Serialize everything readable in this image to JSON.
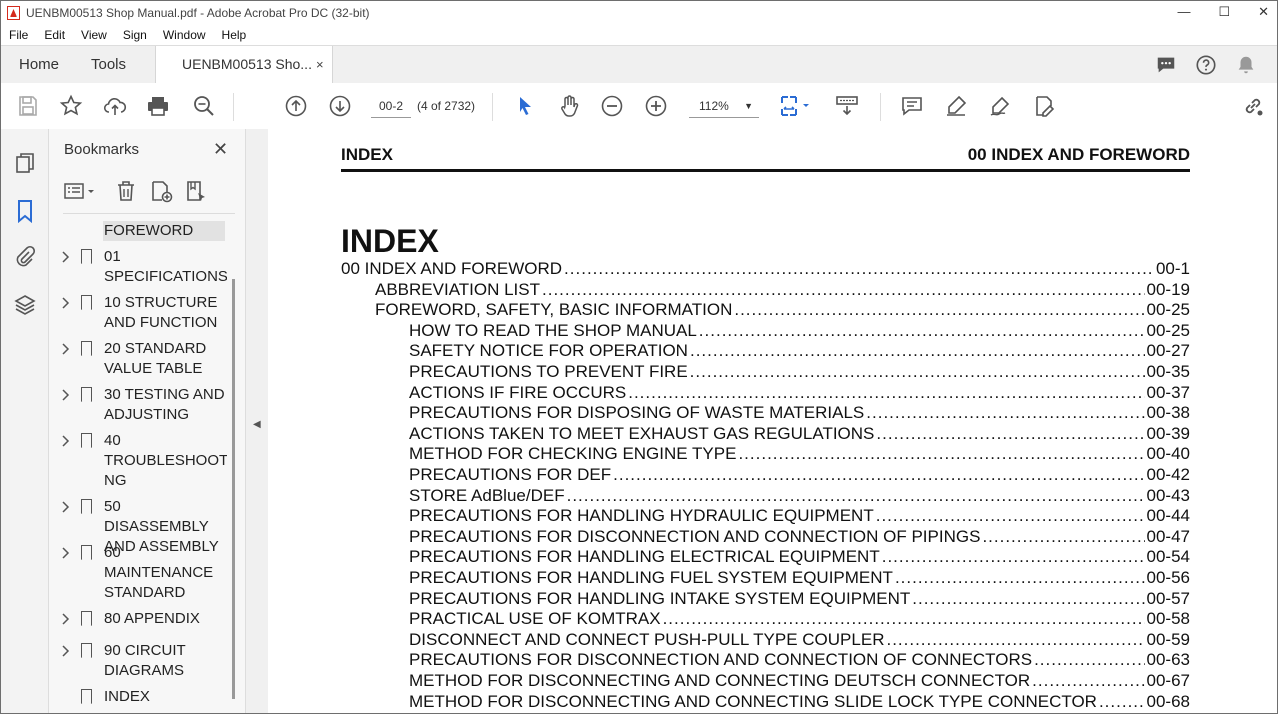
{
  "window": {
    "title": "UENBM00513 Shop Manual.pdf - Adobe Acrobat Pro DC (32-bit)",
    "controls": [
      "—",
      "☐",
      "✕"
    ]
  },
  "menu": [
    "File",
    "Edit",
    "View",
    "Sign",
    "Window",
    "Help"
  ],
  "tabs": {
    "home": "Home",
    "tools": "Tools",
    "doc": "UENBM00513 Sho...",
    "doc_close": "×"
  },
  "toolbar": {
    "page_value": "00-2",
    "page_of": "(4 of 2732)",
    "zoom_value": "112%"
  },
  "bookmarks": {
    "title": "Bookmarks",
    "close": "✕",
    "items": [
      {
        "label": "FOREWORD",
        "selected": true,
        "expandable": false,
        "flag": false
      },
      {
        "label": "01 SPECIFICATIONS",
        "expandable": true,
        "flag": true
      },
      {
        "label": "10 STRUCTURE AND FUNCTION",
        "expandable": true,
        "flag": true
      },
      {
        "label": "20 STANDARD VALUE TABLE",
        "expandable": true,
        "flag": true
      },
      {
        "label": "30 TESTING AND ADJUSTING",
        "expandable": true,
        "flag": true
      },
      {
        "label": "40 TROUBLESHOOTI NG",
        "expandable": true,
        "flag": true
      },
      {
        "label": "50 DISASSEMBLY AND ASSEMBLY",
        "expandable": true,
        "flag": true
      },
      {
        "label": "60 MAINTENANCE STANDARD",
        "expandable": true,
        "flag": true
      },
      {
        "label": "80 APPENDIX",
        "expandable": true,
        "flag": true
      },
      {
        "label": "90 CIRCUIT DIAGRAMS",
        "expandable": true,
        "flag": true
      },
      {
        "label": "INDEX",
        "expandable": false,
        "flag": true
      }
    ]
  },
  "document": {
    "header_left": "INDEX",
    "header_right": "00 INDEX AND FOREWORD",
    "heading": "INDEX",
    "toc": [
      {
        "label": "00 INDEX AND FOREWORD",
        "page": "00-1",
        "level": 0
      },
      {
        "label": "ABBREVIATION LIST",
        "page": "00-19",
        "level": 1
      },
      {
        "label": "FOREWORD, SAFETY, BASIC INFORMATION",
        "page": "00-25",
        "level": 1
      },
      {
        "label": "HOW TO READ THE SHOP MANUAL",
        "page": "00-25",
        "level": 2
      },
      {
        "label": "SAFETY NOTICE FOR OPERATION",
        "page": "00-27",
        "level": 2
      },
      {
        "label": "PRECAUTIONS TO PREVENT FIRE",
        "page": "00-35",
        "level": 2
      },
      {
        "label": "ACTIONS IF FIRE OCCURS",
        "page": "00-37",
        "level": 2
      },
      {
        "label": "PRECAUTIONS FOR DISPOSING OF WASTE MATERIALS",
        "page": "00-38",
        "level": 2
      },
      {
        "label": "ACTIONS TAKEN TO MEET EXHAUST GAS REGULATIONS",
        "page": "00-39",
        "level": 2
      },
      {
        "label": "METHOD FOR CHECKING ENGINE TYPE",
        "page": "00-40",
        "level": 2
      },
      {
        "label": "PRECAUTIONS FOR DEF",
        "page": "00-42",
        "level": 2
      },
      {
        "label": "STORE AdBlue/DEF",
        "page": "00-43",
        "level": 2
      },
      {
        "label": "PRECAUTIONS FOR HANDLING HYDRAULIC EQUIPMENT",
        "page": "00-44",
        "level": 2
      },
      {
        "label": "PRECAUTIONS FOR DISCONNECTION AND CONNECTION OF PIPINGS",
        "page": "00-47",
        "level": 2
      },
      {
        "label": "PRECAUTIONS FOR HANDLING ELECTRICAL EQUIPMENT",
        "page": "00-54",
        "level": 2
      },
      {
        "label": "PRECAUTIONS FOR HANDLING FUEL SYSTEM EQUIPMENT",
        "page": "00-56",
        "level": 2
      },
      {
        "label": "PRECAUTIONS FOR HANDLING INTAKE SYSTEM EQUIPMENT",
        "page": "00-57",
        "level": 2
      },
      {
        "label": "PRACTICAL USE OF KOMTRAX",
        "page": "00-58",
        "level": 2
      },
      {
        "label": "DISCONNECT AND CONNECT PUSH-PULL TYPE COUPLER",
        "page": "00-59",
        "level": 2
      },
      {
        "label": "PRECAUTIONS FOR DISCONNECTION AND CONNECTION OF CONNECTORS",
        "page": "00-63",
        "level": 2
      },
      {
        "label": "METHOD FOR DISCONNECTING AND CONNECTING DEUTSCH CONNECTOR",
        "page": "00-67",
        "level": 2
      },
      {
        "label": "METHOD FOR DISCONNECTING AND CONNECTING SLIDE LOCK TYPE CONNECTOR",
        "page": "00-68",
        "level": 2
      }
    ]
  },
  "colors": {
    "accent_blue": "#2b6cd4",
    "acrobat_red": "#d52b1e",
    "icon_gray": "#555555"
  }
}
